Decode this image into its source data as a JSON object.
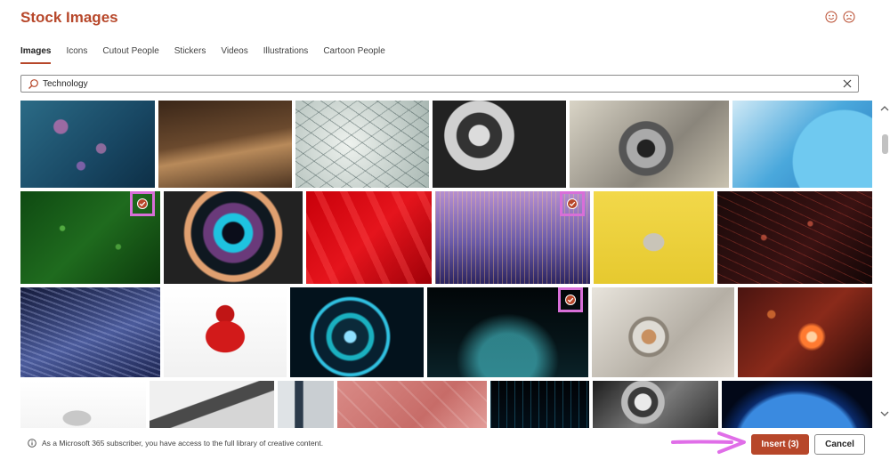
{
  "dialog": {
    "title": "Stock Images"
  },
  "colors": {
    "accent": "#b7472a",
    "highlight": "#d86fd8"
  },
  "tabs": [
    {
      "label": "Images",
      "active": true
    },
    {
      "label": "Icons",
      "active": false
    },
    {
      "label": "Cutout People",
      "active": false
    },
    {
      "label": "Stickers",
      "active": false
    },
    {
      "label": "Videos",
      "active": false
    },
    {
      "label": "Illustrations",
      "active": false
    },
    {
      "label": "Cartoon People",
      "active": false
    }
  ],
  "search": {
    "value": "Technology",
    "icon": "search-icon",
    "clear_icon": "close-icon"
  },
  "images": [
    {
      "subject": "bubbles",
      "selected": false
    },
    {
      "subject": "desk-laptop",
      "selected": false
    },
    {
      "subject": "network-lines",
      "selected": false
    },
    {
      "subject": "film-reel-clapper",
      "selected": false
    },
    {
      "subject": "vintage-camera",
      "selected": false
    },
    {
      "subject": "blue-wafer",
      "selected": false
    },
    {
      "subject": "green-network",
      "selected": true
    },
    {
      "subject": "camera-lens",
      "selected": false
    },
    {
      "subject": "red-abstract",
      "selected": false
    },
    {
      "subject": "purple-data-bars",
      "selected": true
    },
    {
      "subject": "toy-robot-yellow",
      "selected": false
    },
    {
      "subject": "red-network-mesh",
      "selected": false
    },
    {
      "subject": "blue-fabric-waves",
      "selected": false
    },
    {
      "subject": "red-robot",
      "selected": false
    },
    {
      "subject": "light-tunnel",
      "selected": false
    },
    {
      "subject": "digital-wave",
      "selected": true
    },
    {
      "subject": "watch-gears",
      "selected": false
    },
    {
      "subject": "neurons",
      "selected": false
    },
    {
      "subject": "toy-robot-white",
      "selected": false
    },
    {
      "subject": "typing-laptop",
      "selected": false
    },
    {
      "subject": "office-worker",
      "selected": false
    },
    {
      "subject": "pink-desk",
      "selected": false
    },
    {
      "subject": "city-wireframe",
      "selected": false
    },
    {
      "subject": "gears-bw",
      "selected": false
    },
    {
      "subject": "earth-lights",
      "selected": false
    }
  ],
  "footer": {
    "info_text": "As a Microsoft 365 subscriber, you have access to the full library of creative content.",
    "insert_label": "Insert (3)",
    "cancel_label": "Cancel"
  }
}
